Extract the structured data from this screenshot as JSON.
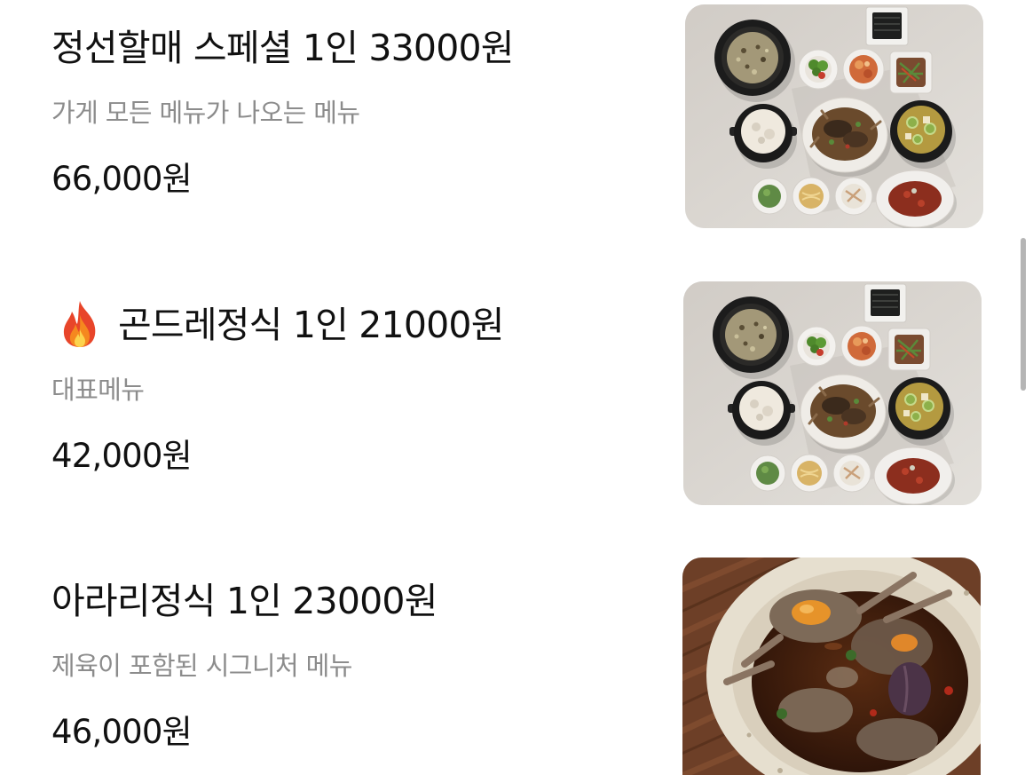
{
  "menu": {
    "items": [
      {
        "title": "정선할매 스페셜 1인 33000원",
        "description": "가게 모든 메뉴가 나오는 메뉴",
        "price": "66,000원"
      },
      {
        "icon": "fire-icon",
        "title": "곤드레정식 1인 21000원",
        "description": "대표메뉴",
        "price": "42,000원"
      },
      {
        "title": "아라리정식 1인 23000원",
        "description": "제육이 포함된 시그니처 메뉴",
        "price": "46,000원"
      }
    ]
  },
  "colors": {
    "background": "#ffffff",
    "text_primary": "#111111",
    "text_secondary": "#8c8c8c",
    "scrollbar": "#b5b5b5"
  }
}
